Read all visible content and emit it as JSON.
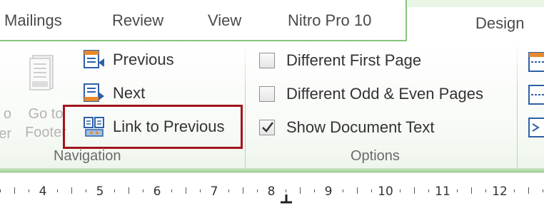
{
  "tabs": {
    "mailings": "Mailings",
    "review": "Review",
    "view": "View",
    "nitro": "Nitro Pro 10",
    "design": "Design"
  },
  "navigation": {
    "group_label": "Navigation",
    "go_to_header_partial": {
      "line1": "o",
      "line2": "er"
    },
    "go_to_footer": {
      "line1": "Go to",
      "line2": "Footer"
    },
    "previous": "Previous",
    "next": "Next",
    "link_to_previous": "Link to Previous"
  },
  "options": {
    "group_label": "Options",
    "different_first_page": {
      "label": "Different First Page",
      "checked": false
    },
    "different_odd_even": {
      "label": "Different Odd & Even Pages",
      "checked": false
    },
    "show_document_text": {
      "label": "Show Document Text",
      "checked": true
    }
  },
  "ruler": {
    "numbers": [
      "4",
      "5",
      "6",
      "7",
      "8",
      "9",
      "10",
      "11",
      "12"
    ]
  },
  "colors": {
    "contextual_accent": "#86c57a",
    "highlight": "#a3141d",
    "icon_blue": "#2f5fa8",
    "icon_orange": "#e8892c"
  }
}
